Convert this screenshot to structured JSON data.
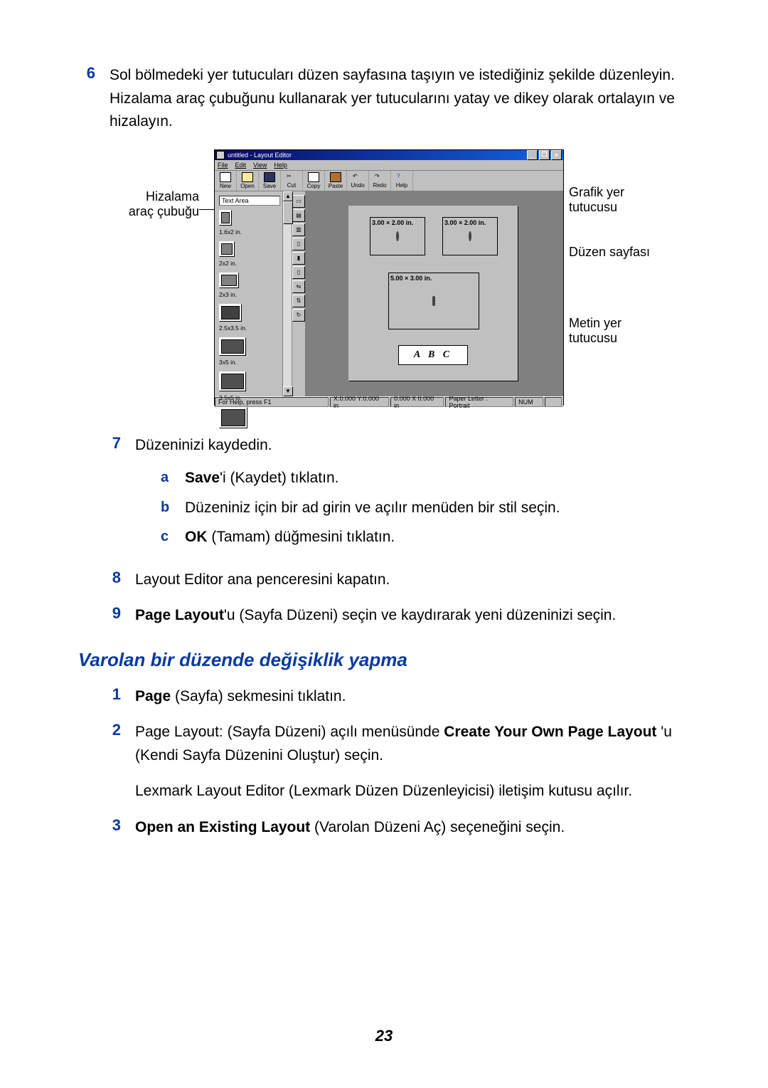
{
  "step6": {
    "num": "6",
    "text": "Sol bölmedeki yer tutucuları düzen sayfasına taşıyın ve istediğiniz şekilde düzenleyin. Hizalama araç çubuğunu kullanarak yer tutucularını yatay ve dikey olarak ortalayın ve hizalayın."
  },
  "callouts": {
    "align_toolbar": "Hizalama\naraç çubuğu",
    "graphic_ph": "Grafik yer\ntutucusu",
    "layout_page": "Düzen sayfası",
    "text_ph": "Metin yer\ntutucusu"
  },
  "window": {
    "title": "untitled - Layout Editor",
    "menus": [
      "File",
      "Edit",
      "View",
      "Help"
    ],
    "toolbar": [
      "New",
      "Open",
      "Save",
      "Cut",
      "Copy",
      "Paste",
      "Undo",
      "Redo",
      "Help"
    ],
    "left_label": "Text Area",
    "placeholders": [
      "1.6x2 in.",
      "2x2 in.",
      "2x3 in.",
      "2.5x3.5 in.",
      "3x5 in.",
      "3.5x5 in."
    ],
    "canvas": {
      "ph1_title": "3.00 × 2.00 in.",
      "ph2_title": "3.00 × 2.00 in.",
      "ph3_title": "5.00 × 3.00 in.",
      "text_ph": "A B C"
    },
    "status": {
      "help": "For Help, press F1",
      "coord": "X:0.000 Y:0.000 in",
      "size": "0.000 X 0.000 in",
      "paper": "Paper Letter : Portrait",
      "num": "NUM"
    },
    "sys_buttons": {
      "min": "_",
      "max": "❐",
      "close": "×"
    }
  },
  "step7": {
    "num": "7",
    "text": "Düzeninizi kaydedin.",
    "a": "a",
    "a_bold": "Save",
    "a_rest": "'i (Kaydet) tıklatın.",
    "b": "b",
    "b_text": "Düzeniniz için bir ad girin ve açılır menüden bir stil seçin.",
    "c": "c",
    "c_bold": "OK",
    "c_rest": " (Tamam) düğmesini tıklatın."
  },
  "step8": {
    "num": "8",
    "text": "Layout Editor ana penceresini kapatın."
  },
  "step9": {
    "num": "9",
    "bold": "Page Layout",
    "rest": "'u (Sayfa Düzeni) seçin ve kaydırarak yeni düzeninizi seçin."
  },
  "section2_title": "Varolan bir düzende değişiklik yapma",
  "sec2": {
    "s1": {
      "num": "1",
      "bold": "Page",
      "rest": " (Sayfa) sekmesini tıklatın."
    },
    "s2": {
      "num": "2",
      "text1": "Page Layout: (Sayfa Düzeni) açılı menüsünde ",
      "bold": "Create Your Own Page Layout ",
      "text2": "'u (Kendi Sayfa Düzenini Oluştur) seçin.",
      "para2": "Lexmark Layout Editor (Lexmark Düzen Düzenleyicisi) iletişim kutusu açılır."
    },
    "s3": {
      "num": "3",
      "bold": "Open an Existing Layout",
      "rest": " (Varolan Düzeni Aç) seçeneğini seçin."
    }
  },
  "page_number": "23"
}
